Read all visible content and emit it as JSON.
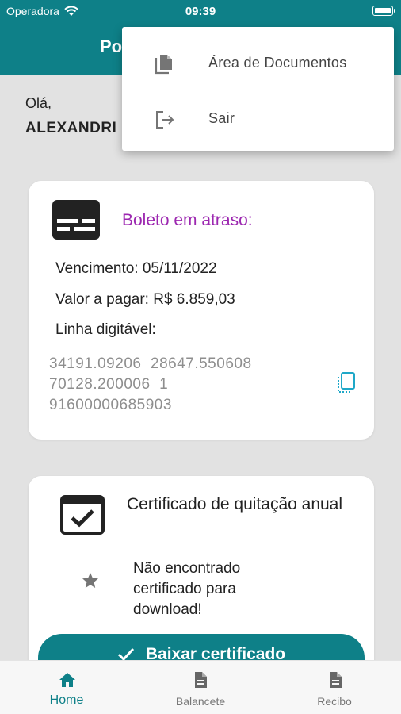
{
  "status_bar": {
    "carrier": "Operadora",
    "time": "09:39"
  },
  "app_bar": {
    "title": "Po"
  },
  "greeting": {
    "hello": "Olá,",
    "name": "ALEXANDRI"
  },
  "menu": {
    "items": [
      {
        "label": "Área de Documentos",
        "icon": "documents-icon"
      },
      {
        "label": "Sair",
        "icon": "logout-icon"
      }
    ]
  },
  "boleto_card": {
    "title": "Boleto em atraso:",
    "due": "Vencimento: 05/11/2022",
    "amount": "Valor a pagar: R$ 6.859,03",
    "line_label": "Linha digitável:",
    "line_value": "34191.09206  28647.550608\n70128.200006  1\n91600000685903"
  },
  "certificate_card": {
    "title": "Certificado de quitação anual",
    "not_found": "Não encontrado certificado para download!",
    "button_label": "Baixar certificado"
  },
  "bottom_nav": {
    "items": [
      {
        "label": "Home",
        "icon": "home-icon",
        "active": true
      },
      {
        "label": "Balancete",
        "icon": "document-icon",
        "active": false
      },
      {
        "label": "Recibo",
        "icon": "document-icon",
        "active": false
      }
    ]
  },
  "colors": {
    "primary": "#0e8088",
    "accent_purple": "#9c27b0",
    "copy_icon": "#1fa8c8"
  }
}
